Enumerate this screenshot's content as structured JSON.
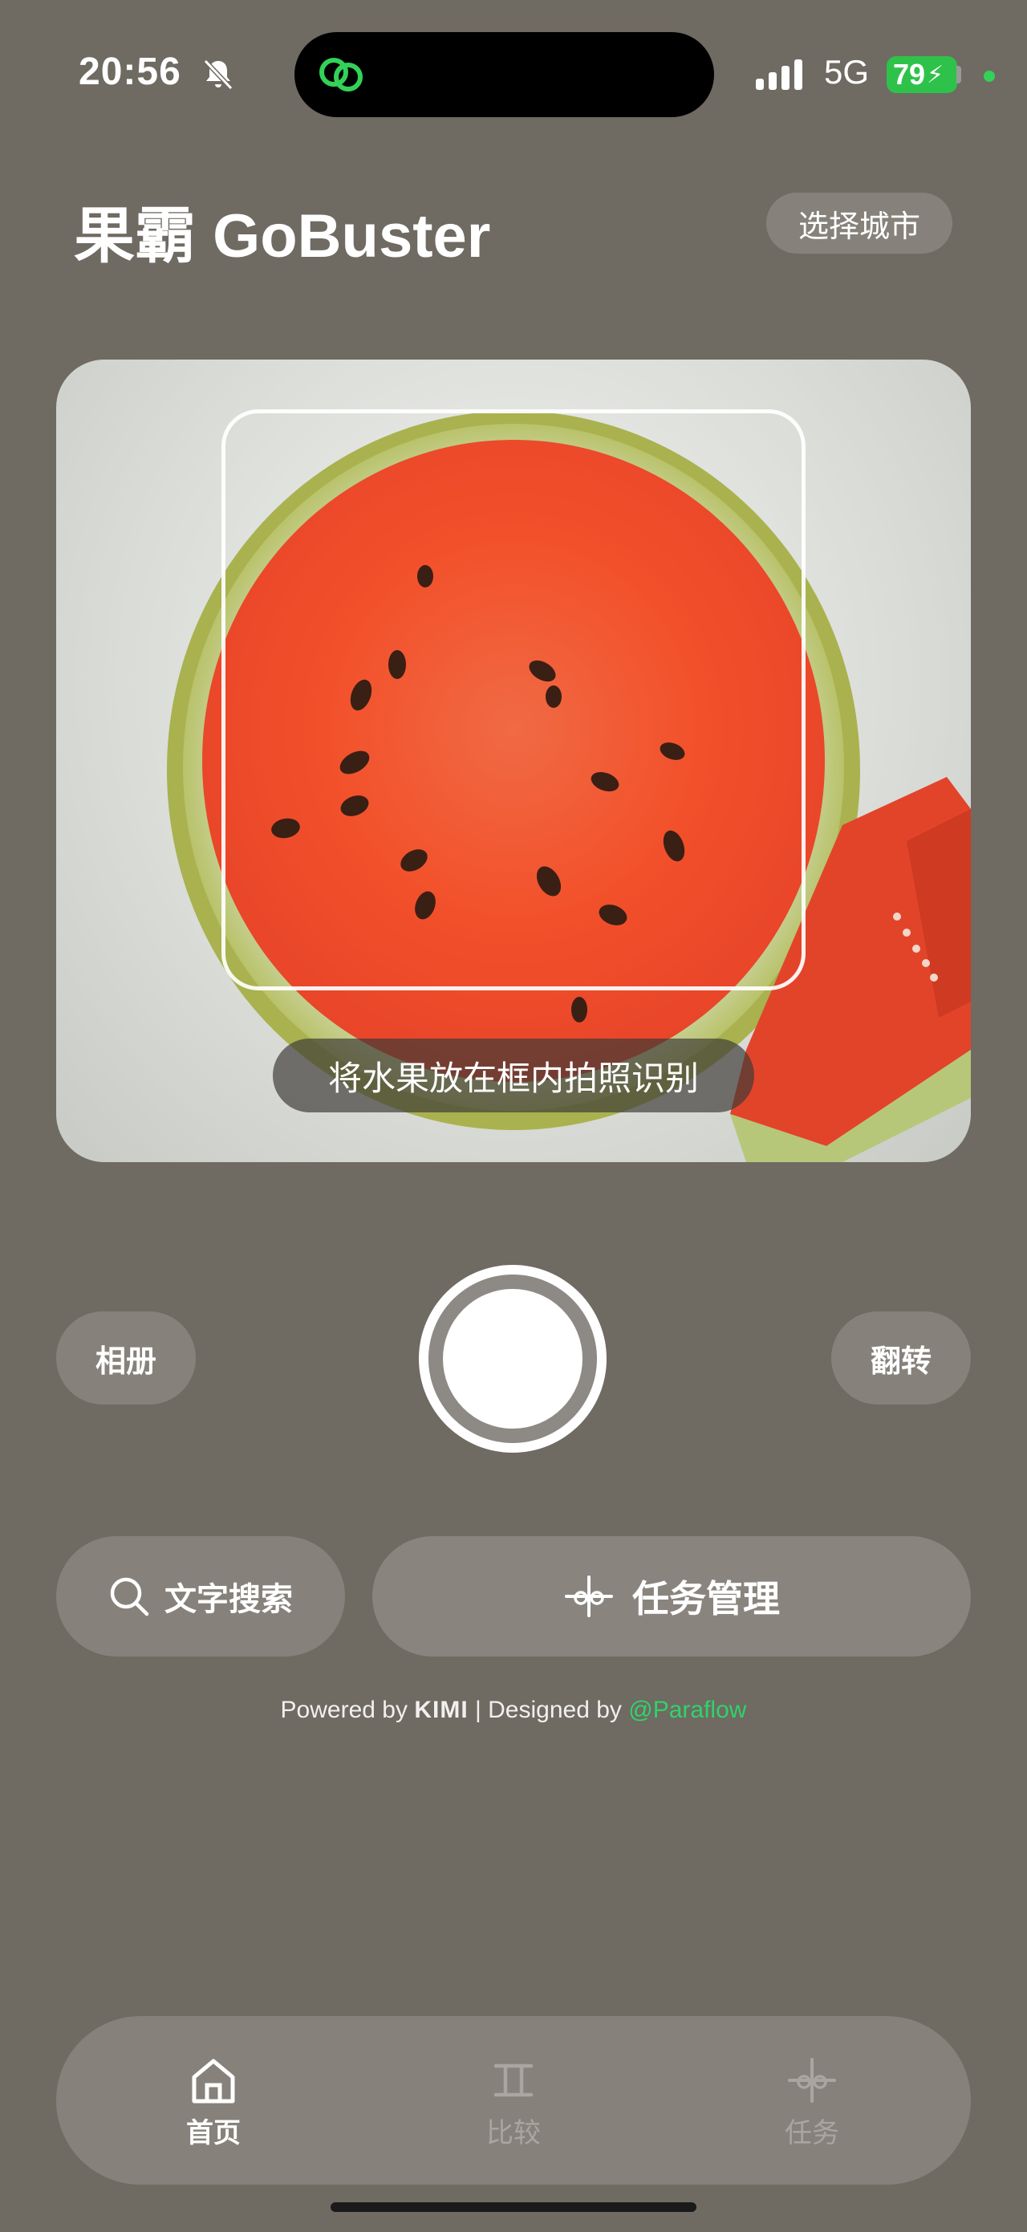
{
  "status_bar": {
    "time": "20:56",
    "network": "5G",
    "battery": "79"
  },
  "header": {
    "title": "果霸 GoBuster",
    "city_button": "选择城市"
  },
  "camera": {
    "hint": "将水果放在框内拍照识别"
  },
  "controls": {
    "album_label": "相册",
    "flip_label": "翻转"
  },
  "actions": {
    "text_search_label": "文字搜索",
    "task_manage_label": "任务管理"
  },
  "footer": {
    "powered_by": "Powered by",
    "kimi": "KIMI",
    "separator": "| Designed by",
    "paraflow": "Paraflow"
  },
  "tabbar": {
    "items": [
      {
        "label": "首页",
        "icon": "home-icon",
        "active": true
      },
      {
        "label": "比较",
        "icon": "compare-icon",
        "active": false
      },
      {
        "label": "任务",
        "icon": "task-icon",
        "active": false
      }
    ]
  },
  "colors": {
    "background": "#6f6a62",
    "accent_green": "#2ec24a",
    "paraflow_green": "#2fd36a"
  }
}
